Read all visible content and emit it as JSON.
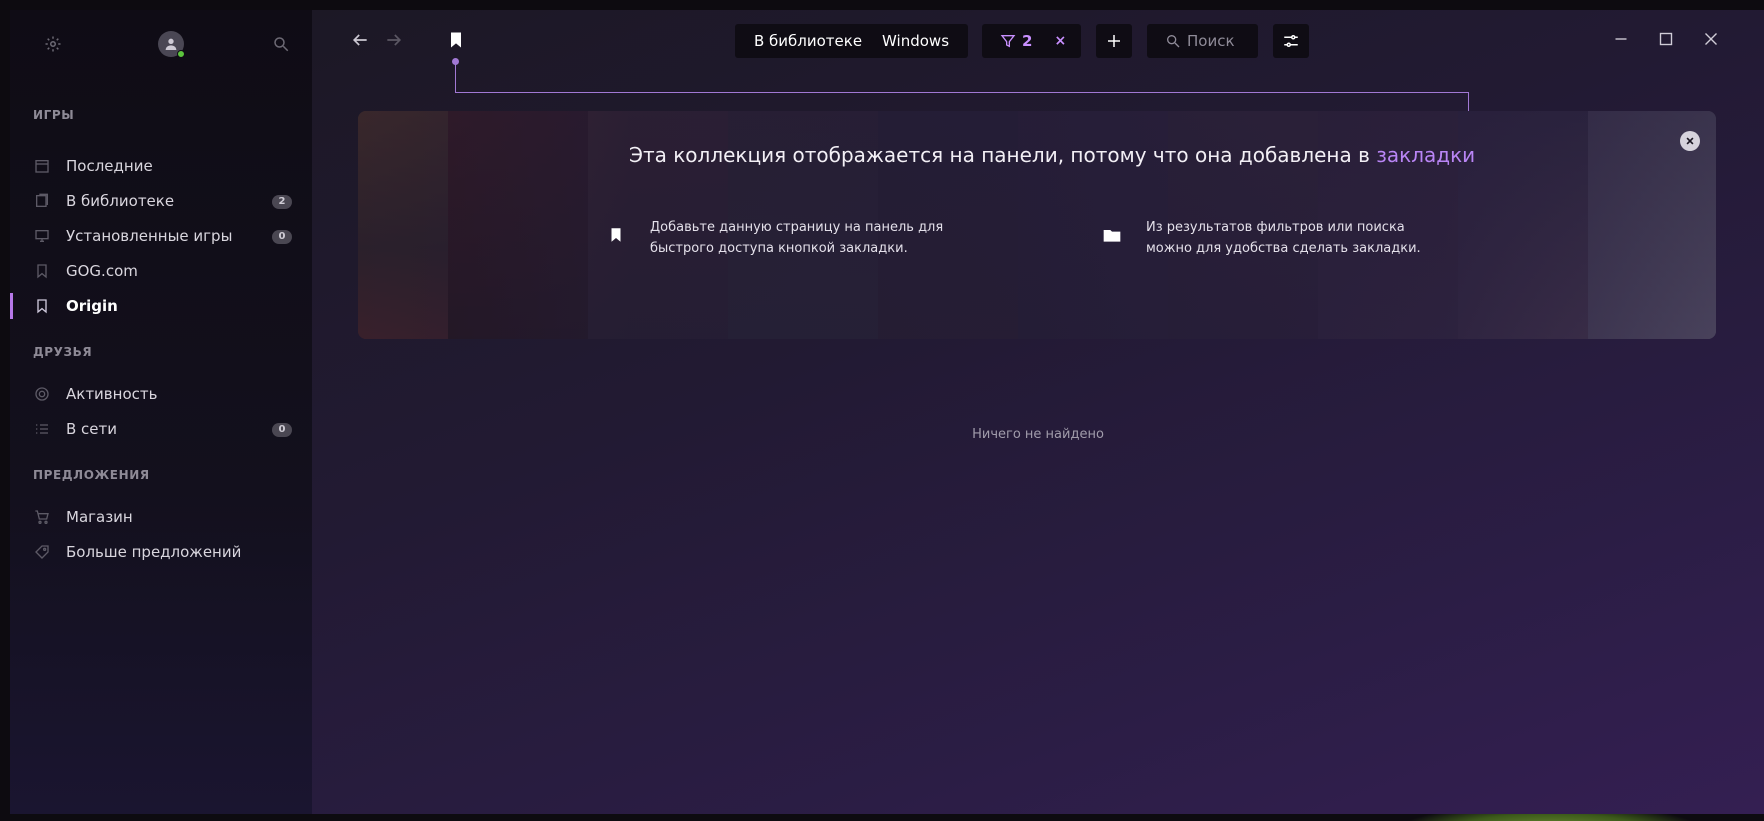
{
  "sidebar": {
    "sections": {
      "games": "ИГРЫ",
      "friends": "ДРУЗЬЯ",
      "offers": "ПРЕДЛОЖЕНИЯ"
    },
    "games_items": [
      {
        "label": "Последние",
        "icon": "calendar-icon"
      },
      {
        "label": "В библиотеке",
        "icon": "library-icon",
        "badge": "2"
      },
      {
        "label": "Установленные игры",
        "icon": "monitor-icon",
        "badge": "0"
      },
      {
        "label": "GOG.com",
        "icon": "bookmark-outline-icon"
      },
      {
        "label": "Origin",
        "icon": "bookmark-outline-icon",
        "active": true
      }
    ],
    "friends_items": [
      {
        "label": "Активность",
        "icon": "activity-icon"
      },
      {
        "label": "В сети",
        "icon": "list-icon",
        "badge": "0"
      }
    ],
    "offers_items": [
      {
        "label": "Магазин",
        "icon": "cart-icon"
      },
      {
        "label": "Больше предложений",
        "icon": "tag-icon"
      }
    ]
  },
  "toolbar": {
    "scope_library": "В библиотеке",
    "scope_platform": "Windows",
    "filter_count": "2",
    "filter_clear": "×",
    "search_placeholder": "Поиск"
  },
  "banner": {
    "title_prefix": "Эта коллекция отображается на панели, потому что она добавлена в",
    "title_link": "закладки",
    "tip1": "Добавьте данную страницу на панель для быстрого доступа кнопкой закладки.",
    "tip1_line1": "Добавьте данную страницу на панель для",
    "tip1_line2": "быстрого доступа кнопкой закладки.",
    "tip2_line1": "Из результатов фильтров или поиска",
    "tip2_line2": "можно для удобства сделать закладки."
  },
  "empty_message": "Ничего не найдено",
  "colors": {
    "accent": "#b678e8",
    "link": "#b985f5",
    "filter": "#c990ff",
    "online": "#5cc43d"
  }
}
